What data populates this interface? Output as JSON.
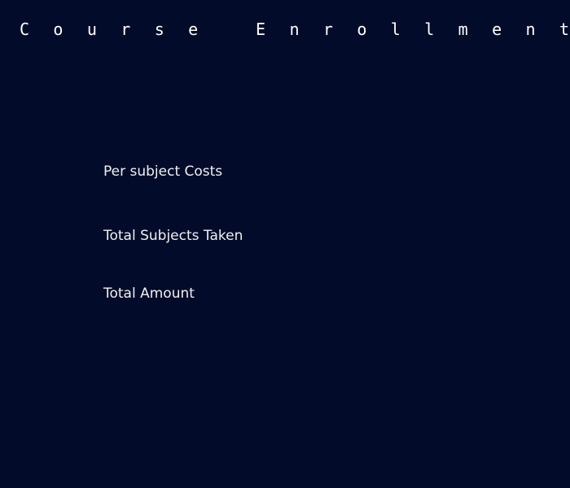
{
  "page": {
    "title": "Course Enrollment"
  },
  "form": {
    "per_subject_cost_label": "Per subject Costs",
    "total_subjects_label": "Total Subjects Taken",
    "total_amount_label": "Total Amount"
  },
  "colors": {
    "background": "#020b2a",
    "text": "#f0f0f0"
  }
}
